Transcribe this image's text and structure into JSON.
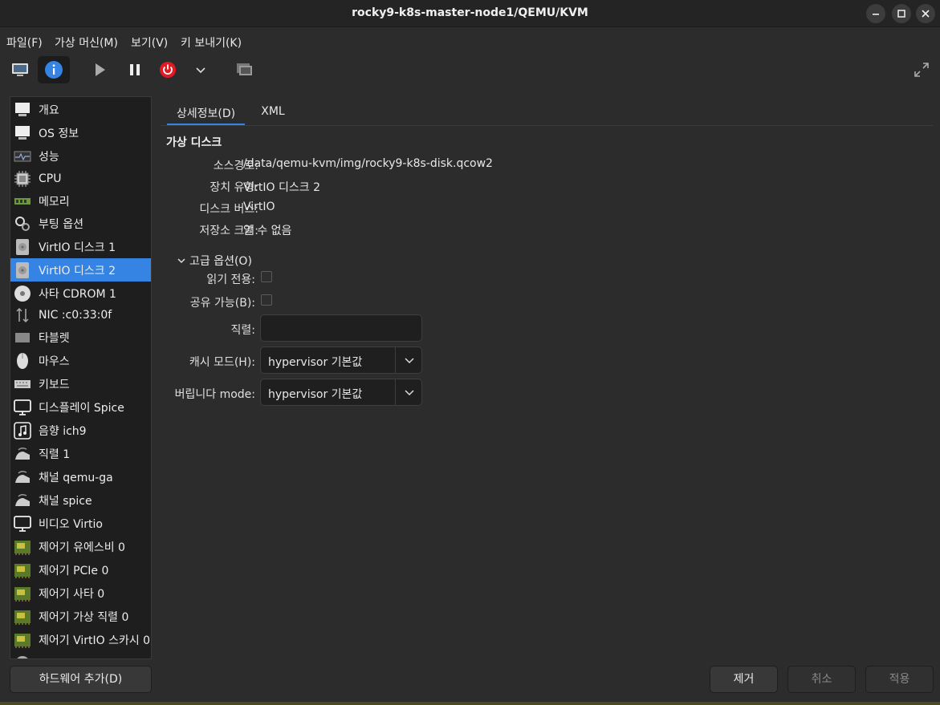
{
  "window": {
    "title": "rocky9-k8s-master-node1/QEMU/KVM"
  },
  "menu": [
    {
      "label": "파일(F)"
    },
    {
      "label": "가상 머신(M)"
    },
    {
      "label": "보기(V)"
    },
    {
      "label": "키 보내기(K)"
    }
  ],
  "sidebar": {
    "items": [
      {
        "label": "개요",
        "icon": "overview-icon"
      },
      {
        "label": "OS 정보",
        "icon": "os-info-icon"
      },
      {
        "label": "성능",
        "icon": "performance-icon"
      },
      {
        "label": "CPU",
        "icon": "cpu-icon"
      },
      {
        "label": "메모리",
        "icon": "memory-icon"
      },
      {
        "label": "부팅 옵션",
        "icon": "boot-options-icon"
      },
      {
        "label": "VirtIO 디스크 1",
        "icon": "disk-icon"
      },
      {
        "label": "VirtIO 디스크 2",
        "icon": "disk-icon",
        "selected": true
      },
      {
        "label": "사타 CDROM 1",
        "icon": "cdrom-icon"
      },
      {
        "label": "NIC :c0:33:0f",
        "icon": "network-icon"
      },
      {
        "label": "타블렛",
        "icon": "tablet-icon"
      },
      {
        "label": "마우스",
        "icon": "mouse-icon"
      },
      {
        "label": "키보드",
        "icon": "keyboard-icon"
      },
      {
        "label": "디스플레이 Spice",
        "icon": "display-icon"
      },
      {
        "label": "음향 ich9",
        "icon": "sound-icon"
      },
      {
        "label": "직렬 1",
        "icon": "serial-icon"
      },
      {
        "label": "채널 qemu-ga",
        "icon": "channel-icon"
      },
      {
        "label": "채널 spice",
        "icon": "channel-icon"
      },
      {
        "label": "비디오 Virtio",
        "icon": "video-icon"
      },
      {
        "label": "제어기 유에스비 0",
        "icon": "controller-icon"
      },
      {
        "label": "제어기 PCIe 0",
        "icon": "controller-icon"
      },
      {
        "label": "제어기 사타 0",
        "icon": "controller-icon"
      },
      {
        "label": "제어기 가상 직렬 0",
        "icon": "controller-icon"
      },
      {
        "label": "제어기 VirtIO 스카시 0",
        "icon": "controller-icon"
      }
    ],
    "add_hardware_label": "하드웨어 추가(D)"
  },
  "tabs": [
    {
      "label": "상세정보(D)",
      "active": true
    },
    {
      "label": "XML"
    }
  ],
  "details": {
    "section_title": "가상 디스크",
    "source_path_label": "소스경로:",
    "source_path_value": "/data/qemu-kvm/img/rocky9-k8s-disk.qcow2",
    "device_type_label": "장치 유형:",
    "device_type_value": "VirtIO 디스크 2",
    "disk_bus_label": "디스크 버스:",
    "disk_bus_value": "VirtIO",
    "storage_size_label": "저장소 크기:",
    "storage_size_value": "알 수 없음",
    "advanced_label": "고급 옵션(O)",
    "readonly_label": "읽기 전용:",
    "readonly_checked": false,
    "shareable_label": "공유 가능(B):",
    "shareable_checked": false,
    "serial_label": "직렬:",
    "serial_value": "",
    "cache_label": "캐시 모드(H):",
    "cache_value": "hypervisor 기본값",
    "discard_label": "버립니다 mode:",
    "discard_value": "hypervisor 기본값"
  },
  "buttons": {
    "remove": "제거",
    "cancel": "취소",
    "apply": "적용"
  },
  "colors": {
    "accent": "#3584e4",
    "power": "#e01b24",
    "background": "#2c2c2c"
  }
}
